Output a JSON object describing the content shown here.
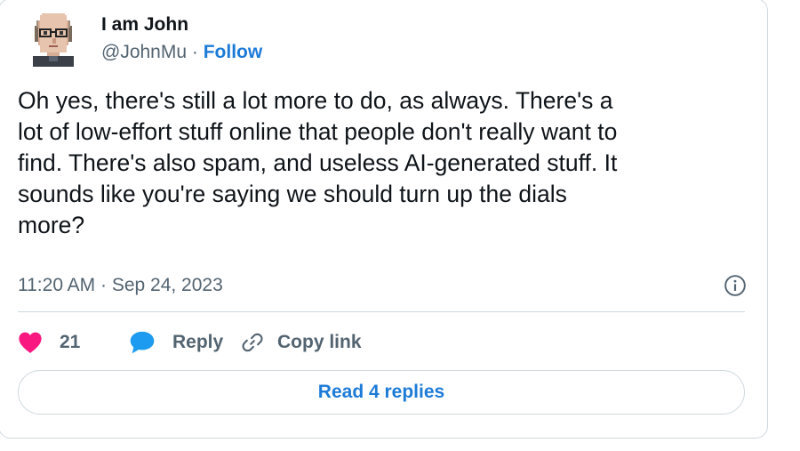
{
  "author": {
    "display_name": "I am John",
    "handle": "@JohnMu",
    "separator": " · ",
    "follow_label": "Follow"
  },
  "tweet": {
    "text": "Oh yes, there's still a lot more to do, as always. There's a\nlot of low-effort stuff online that people don't really want to\nfind. There's also spam, and useless AI-generated stuff. It\nsounds like you're saying we should turn up the dials\nmore?",
    "timestamp": "11:20 AM · Sep 24, 2023"
  },
  "actions": {
    "like_count": "21",
    "reply_label": "Reply",
    "copy_link_label": "Copy link"
  },
  "read_replies_label": "Read 4 replies",
  "icons": {
    "avatar": "pixel-art-avatar",
    "info": "info-icon",
    "like": "heart-icon",
    "reply": "speech-bubble-icon",
    "copy": "link-icon"
  },
  "colors": {
    "link_blue": "#1d7bd7",
    "heart_pink": "#f91880",
    "reply_blue": "#1d9bf0",
    "secondary_text": "#536471",
    "border": "#cfd9de"
  }
}
